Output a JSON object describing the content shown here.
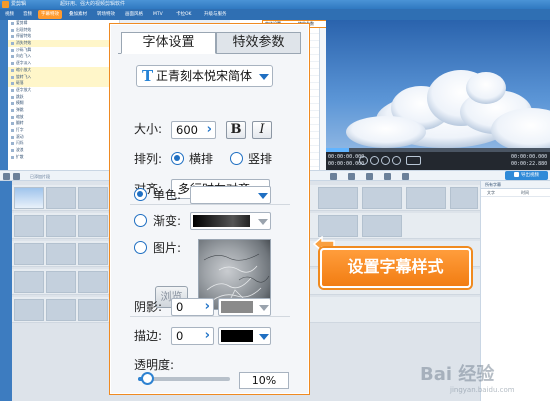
{
  "app": {
    "name": "爱剪辑",
    "tagline": "超好用、强大的视频剪辑软件"
  },
  "menu": [
    "视频",
    "音频",
    "字幕特效",
    "叠加素材",
    "转场特效",
    "画面风格",
    "MTV",
    "卡拉OK",
    "升级与服务"
  ],
  "menu_active_index": 2,
  "top_tabs": {
    "a": "字体设置",
    "b": "特效参数"
  },
  "tree_items": [
    {
      "label": "爱剪辑",
      "highlight": false
    },
    {
      "label": "出现特效",
      "highlight": false
    },
    {
      "label": "停留特效",
      "highlight": false
    },
    {
      "label": "消失特效",
      "highlight": true
    },
    {
      "label": "沙砾飞舞",
      "highlight": false
    },
    {
      "label": "向右飞入",
      "highlight": false
    },
    {
      "label": "逐字淡入",
      "highlight": false
    },
    {
      "label": "缩小放大",
      "highlight": true
    },
    {
      "label": "旋转飞入",
      "highlight": true
    },
    {
      "label": "砸落",
      "highlight": true
    },
    {
      "label": "逐字放大",
      "highlight": false
    },
    {
      "label": "跳跃",
      "highlight": false
    },
    {
      "label": "模糊",
      "highlight": false
    },
    {
      "label": "弹跳",
      "highlight": false
    },
    {
      "label": "缩放",
      "highlight": false
    },
    {
      "label": "翻转",
      "highlight": false
    },
    {
      "label": "打字",
      "highlight": false
    },
    {
      "label": "滚动",
      "highlight": false
    },
    {
      "label": "闪烁",
      "highlight": false
    },
    {
      "label": "波浪",
      "highlight": false
    },
    {
      "label": "扩散",
      "highlight": false
    }
  ],
  "player": {
    "current_time": "00:00:00.000",
    "total_time": "00:00:00.000",
    "duration_time": "00:00:22.880",
    "position_time": "00:00:00.000"
  },
  "timeline_hint": "已添加片段",
  "export_label": "导出视频",
  "right_list": {
    "head": "所有字幕",
    "col_a": "文字",
    "col_b": "时间"
  },
  "panel": {
    "tab_font": "字体设置",
    "tab_effect": "特效参数",
    "font_icon": "T",
    "font_name": "正青刻本悦宋简体",
    "size_label": "大小:",
    "size_value": "600",
    "bold_label": "B",
    "italic_label": "I",
    "layout_label": "排列:",
    "layout_horizontal": "横排",
    "layout_vertical": "竖排",
    "layout_selected": "horizontal",
    "align_label": "对齐:",
    "align_value": "多行时左对齐",
    "color_single_label": "单色:",
    "color_gradient_label": "渐变:",
    "color_image_label": "图片:",
    "color_mode_selected": "single",
    "browse_label": "浏览",
    "shadow_label": "阴影:",
    "shadow_value": "0",
    "stroke_label": "描边:",
    "stroke_value": "0",
    "opacity_label": "透明度:",
    "opacity_value": "10%",
    "opacity_fraction": 0.1,
    "single_color": "#ffffff",
    "shadow_color": "#8a8a8a",
    "stroke_color": "#000000"
  },
  "callout": "设置字幕样式",
  "colors": {
    "accent": "#f08a1f",
    "brand_blue": "#2f6fb3",
    "radio_blue": "#1f6fc2"
  }
}
